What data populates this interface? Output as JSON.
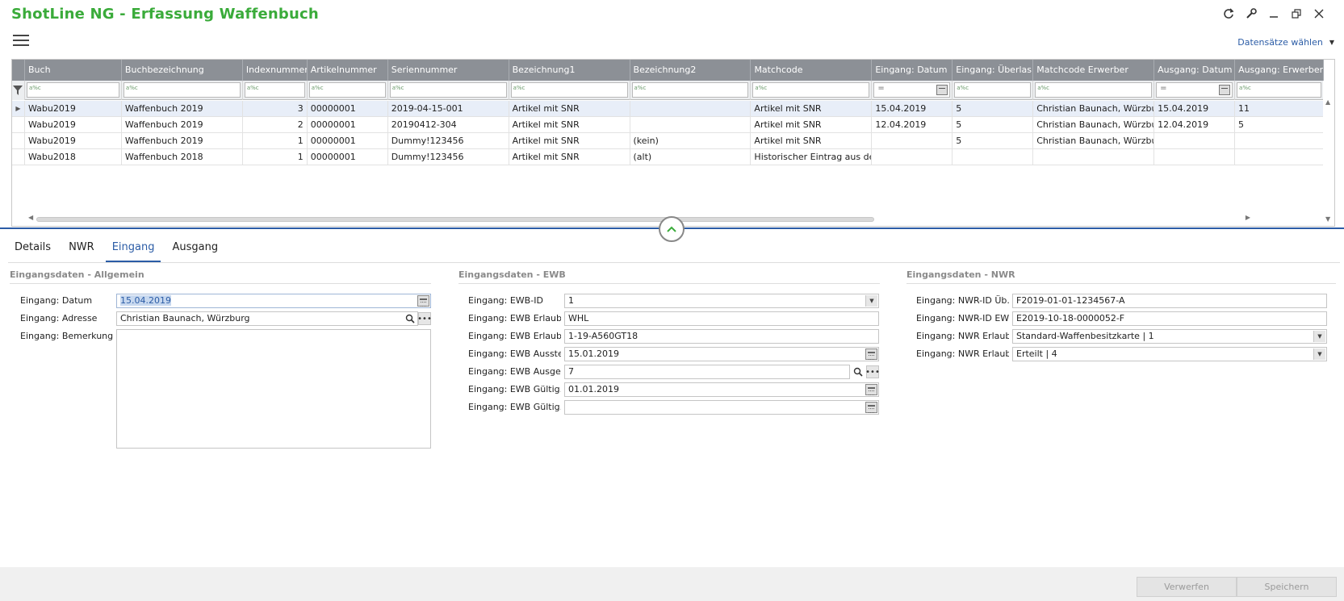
{
  "app": {
    "title": "ShotLine NG - Erfassung Waffenbuch",
    "select_records_label": "Datensätze wählen"
  },
  "grid": {
    "columns": [
      "Buch",
      "Buchbezeichnung",
      "Indexnummer",
      "Artikelnummer",
      "Seriennummer",
      "Bezeichnung1",
      "Bezeichnung2",
      "Matchcode",
      "Eingang: Datum",
      "Eingang: Überlas...",
      "Matchcode Erwerber",
      "Ausgang: Datum",
      "Ausgang: Erwerber"
    ],
    "filter_op": "a%c",
    "filter_eq": "=",
    "rows": [
      [
        "Wabu2019",
        "Waffenbuch 2019",
        "3",
        "00000001",
        "2019-04-15-001",
        "Artikel mit SNR",
        "",
        "Artikel mit SNR",
        "15.04.2019",
        "5",
        "Christian Baunach, Würzburg",
        "15.04.2019",
        "11"
      ],
      [
        "Wabu2019",
        "Waffenbuch 2019",
        "2",
        "00000001",
        "20190412-304",
        "Artikel mit SNR",
        "",
        "Artikel mit SNR",
        "12.04.2019",
        "5",
        "Christian Baunach, Würzburg",
        "12.04.2019",
        "5"
      ],
      [
        "Wabu2019",
        "Waffenbuch 2019",
        "1",
        "00000001",
        "Dummy!123456",
        "Artikel mit SNR",
        "(kein)",
        "Artikel mit SNR",
        "",
        "5",
        "Christian Baunach, Würzburg",
        "",
        ""
      ],
      [
        "Wabu2018",
        "Waffenbuch 2018",
        "1",
        "00000001",
        "Dummy!123456",
        "Artikel mit SNR",
        "(alt)",
        "Historischer Eintrag aus de...",
        "",
        "",
        "",
        "",
        ""
      ]
    ]
  },
  "tabs": {
    "details": "Details",
    "nwr": "NWR",
    "eingang": "Eingang",
    "ausgang": "Ausgang"
  },
  "allgemein": {
    "title": "Eingangsdaten - Allgemein",
    "datum_label": "Eingang: Datum",
    "datum_value": "15.04.2019",
    "adresse_label": "Eingang: Adresse",
    "adresse_value": "Christian Baunach, Würzburg",
    "bemerkung_label": "Eingang: Bemerkung"
  },
  "ewb": {
    "title": "Eingangsdaten - EWB",
    "fields": [
      {
        "label": "Eingang: EWB-ID",
        "value": "1"
      },
      {
        "label": "Eingang: EWB Erlaub...",
        "value": "WHL"
      },
      {
        "label": "Eingang: EWB Erlaub...",
        "value": "1-19-A560GT18"
      },
      {
        "label": "Eingang: EWB Ausstel...",
        "value": "15.01.2019"
      },
      {
        "label": "Eingang: EWB Ausges...",
        "value": "7"
      },
      {
        "label": "Eingang: EWB Gültig...",
        "value": "01.01.2019"
      },
      {
        "label": "Eingang: EWB Gültig...",
        "value": ""
      }
    ]
  },
  "nwr": {
    "title": "Eingangsdaten - NWR",
    "fields": [
      {
        "label": "Eingang: NWR-ID Üb...",
        "value": "F2019-01-01-1234567-A"
      },
      {
        "label": "Eingang: NWR-ID EWB",
        "value": "E2019-10-18-0000052-F"
      },
      {
        "label": "Eingang: NWR Erlaub...",
        "value": "Standard-Waffenbesitzkarte  |  1"
      },
      {
        "label": "Eingang: NWR Erlaub...",
        "value": "Erteilt  |  4"
      }
    ]
  },
  "footer": {
    "discard": "Verwerfen",
    "save": "Speichern"
  },
  "colors": {
    "title_green": "#3aab3a",
    "accent_blue": "#2b5ca6",
    "header_gray": "#8c9096"
  }
}
